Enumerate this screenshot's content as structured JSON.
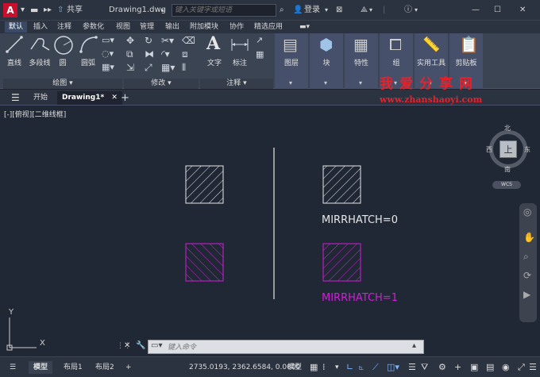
{
  "titlebar": {
    "logo": "A",
    "share": "共享",
    "doc_title": "Drawing1.dwg",
    "search_placeholder": "键入关键字或短语",
    "login": "登录"
  },
  "ribbon_tabs": [
    "默认",
    "插入",
    "注释",
    "参数化",
    "视图",
    "管理",
    "输出",
    "附加模块",
    "协作",
    "精选应用"
  ],
  "ribbon": {
    "draw_tools": [
      "直线",
      "多段线",
      "圆",
      "圆弧"
    ],
    "draw_panel": "绘图",
    "modify_panel": "修改",
    "annotation_tools": [
      "文字",
      "标注"
    ],
    "annotation_panel": "注释",
    "big_tools": [
      "图层",
      "块",
      "特性",
      "组",
      "实用工具",
      "剪贴板"
    ]
  },
  "doc_tabs": {
    "start": "开始",
    "active": "Drawing1*",
    "add": "+"
  },
  "viewport": {
    "label": "[-][俯视][二维线框]",
    "viewcube": {
      "north": "北",
      "south": "南",
      "east": "东",
      "west": "西",
      "top": "上",
      "wcs": "WCS"
    }
  },
  "drawing": {
    "label_top": "MIRRHATCH=0",
    "label_bottom": "MIRRHATCH=1",
    "colors": {
      "white": "#e6e6e6",
      "magenta": "#d21ed8"
    }
  },
  "ucs": {
    "x": "X",
    "y": "Y"
  },
  "command_line": {
    "placeholder": "键入命令"
  },
  "statusbar": {
    "tabs": [
      "模型",
      "布局1",
      "布局2"
    ],
    "coords": "2735.0193, 2362.6584, 0.0000",
    "model_btn": "模型"
  },
  "watermark": {
    "cn": "我爱分享网",
    "url": "www.zhanshaoyi.com"
  }
}
